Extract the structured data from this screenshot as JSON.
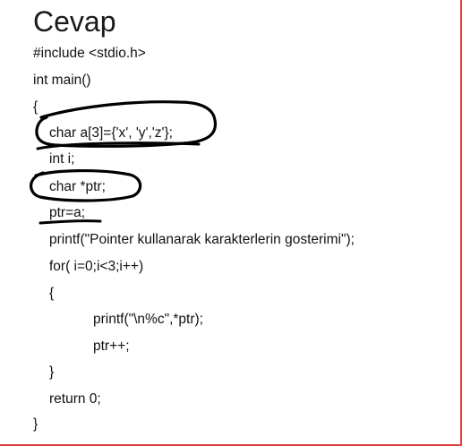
{
  "slide": {
    "title": "Cevap",
    "code_lines": [
      "#include <stdio.h>",
      "int main()",
      "{",
      "char a[3]={'x', 'y','z'};",
      "int i;",
      "char *ptr;",
      "ptr=a;",
      "printf(\"Pointer kullanarak karakterlerin gosterimi\");",
      "for( i=0;i<3;i++)",
      "{",
      "printf(\"\\n%c\",*ptr);",
      "ptr++;",
      "}",
      "return 0;",
      "}"
    ]
  },
  "colors": {
    "frame": "#d94040",
    "ink": "#000000"
  }
}
